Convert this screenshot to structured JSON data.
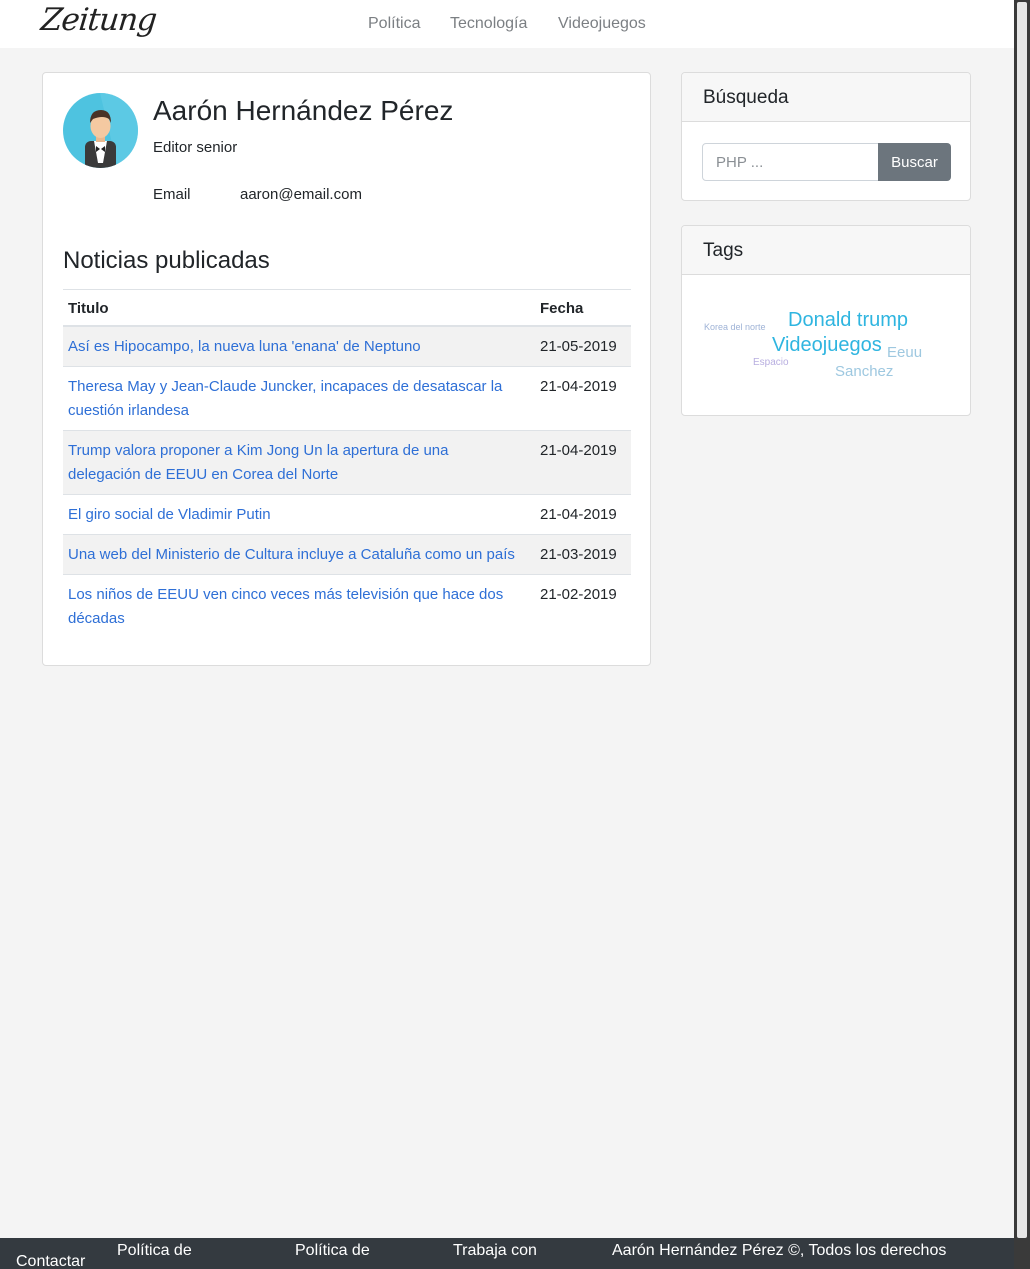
{
  "navbar": {
    "logo": "Zeitung",
    "links": [
      "Política",
      "Tecnología",
      "Videojuegos"
    ]
  },
  "profile": {
    "name": "Aarón Hernández Pérez",
    "role": "Editor senior",
    "email_label": "Email",
    "email": "aaron@email.com"
  },
  "news": {
    "title": "Noticias publicadas",
    "col_title": "Titulo",
    "col_date": "Fecha",
    "rows": [
      {
        "title": "Así es Hipocampo, la nueva luna 'enana' de Neptuno",
        "date": "21-05-2019"
      },
      {
        "title": "Theresa May y Jean-Claude Juncker, incapaces de desatascar la cuestión irlandesa",
        "date": "21-04-2019"
      },
      {
        "title": "Trump valora proponer a Kim Jong Un la apertura de una delegación de EEUU en Corea del Norte",
        "date": "21-04-2019"
      },
      {
        "title": "El giro social de Vladimir Putin",
        "date": "21-04-2019"
      },
      {
        "title": "Una web del Ministerio de Cultura incluye a Cataluña como un país",
        "date": "21-03-2019"
      },
      {
        "title": "Los niños de EEUU ven cinco veces más televisión que hace dos décadas",
        "date": "21-02-2019"
      }
    ]
  },
  "search": {
    "title": "Búsqueda",
    "placeholder": "PHP ...",
    "button": "Buscar"
  },
  "tags": {
    "title": "Tags",
    "items": [
      {
        "label": "Korea del norte",
        "color": "#9fb3d6"
      },
      {
        "label": "Donald trump",
        "color": "#2fb5e0"
      },
      {
        "label": "Videojuegos",
        "color": "#2fb5e0"
      },
      {
        "label": "Eeuu",
        "color": "#9ec8e0"
      },
      {
        "label": "Espacio",
        "color": "#b8aee0"
      },
      {
        "label": "Sanchez",
        "color": "#9ec8e0"
      }
    ]
  },
  "footer": {
    "contact": "Contactar",
    "privacy": "Política de",
    "cookies": "Política de",
    "jobs": "Trabaja con",
    "copyright": "Aarón Hernández Pérez ©, Todos los derechos"
  }
}
